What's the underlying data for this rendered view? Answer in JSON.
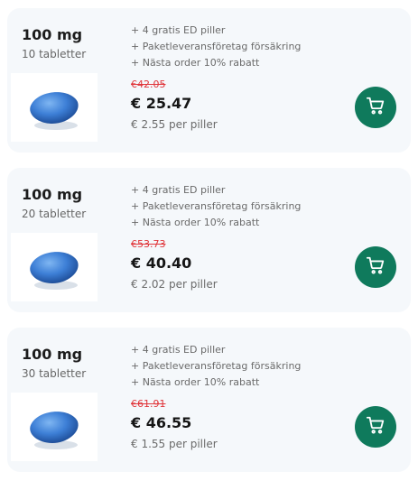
{
  "offers": [
    {
      "dose": "100 mg",
      "count": "10 tabletter",
      "benefits": [
        "+ 4 gratis ED piller",
        "+ Paketleveransföretag försäkring",
        "+ Nästa order 10% rabatt"
      ],
      "old_price": "€42.05",
      "price": "€ 25.47",
      "per_pill": "€ 2.55 per piller",
      "cart_icon": "shopping-cart-icon"
    },
    {
      "dose": "100 mg",
      "count": "20 tabletter",
      "benefits": [
        "+ 4 gratis ED piller",
        "+ Paketleveransföretag försäkring",
        "+ Nästa order 10% rabatt"
      ],
      "old_price": "€53.73",
      "price": "€ 40.40",
      "per_pill": "€ 2.02 per piller",
      "cart_icon": "shopping-cart-icon"
    },
    {
      "dose": "100 mg",
      "count": "30 tabletter",
      "benefits": [
        "+ 4 gratis ED piller",
        "+ Paketleveransföretag försäkring",
        "+ Nästa order 10% rabatt"
      ],
      "old_price": "€61.91",
      "price": "€ 46.55",
      "per_pill": "€ 1.55 per piller",
      "cart_icon": "shopping-cart-icon"
    }
  ],
  "colors": {
    "accent": "#0f7a5c",
    "strike": "#e0353a",
    "pill": "#3d7fd6"
  }
}
